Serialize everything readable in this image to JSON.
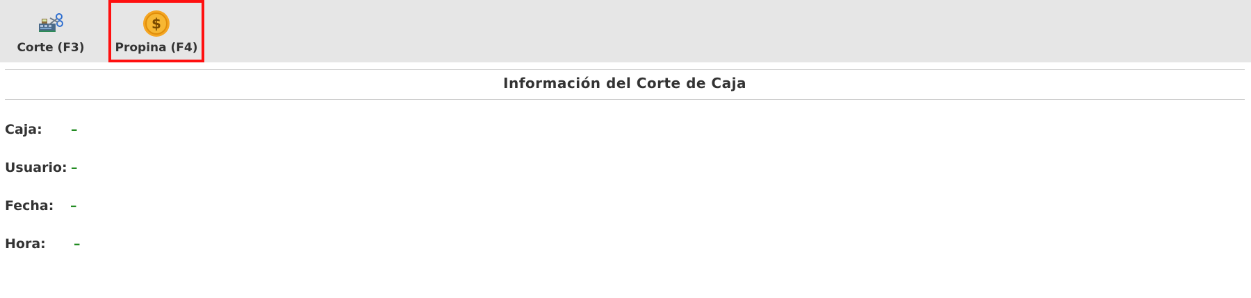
{
  "toolbar": {
    "corte_label": "Corte (F3)",
    "propina_label": "Propina (F4)"
  },
  "section": {
    "title": "Información del Corte de Caja"
  },
  "fields": {
    "caja": {
      "label": "Caja:",
      "value": "–"
    },
    "usuario": {
      "label": "Usuario:",
      "value": "–"
    },
    "fecha": {
      "label": "Fecha:",
      "value": "–"
    },
    "hora": {
      "label": "Hora:",
      "value": "–"
    }
  },
  "colors": {
    "toolbar_bg": "#e6e6e6",
    "highlight_border": "#ff1010",
    "value_color": "#228B22",
    "coin_color": "#f5a623"
  },
  "icons": {
    "corte": "cash-register-scissors-icon",
    "propina": "dollar-coin-icon"
  }
}
